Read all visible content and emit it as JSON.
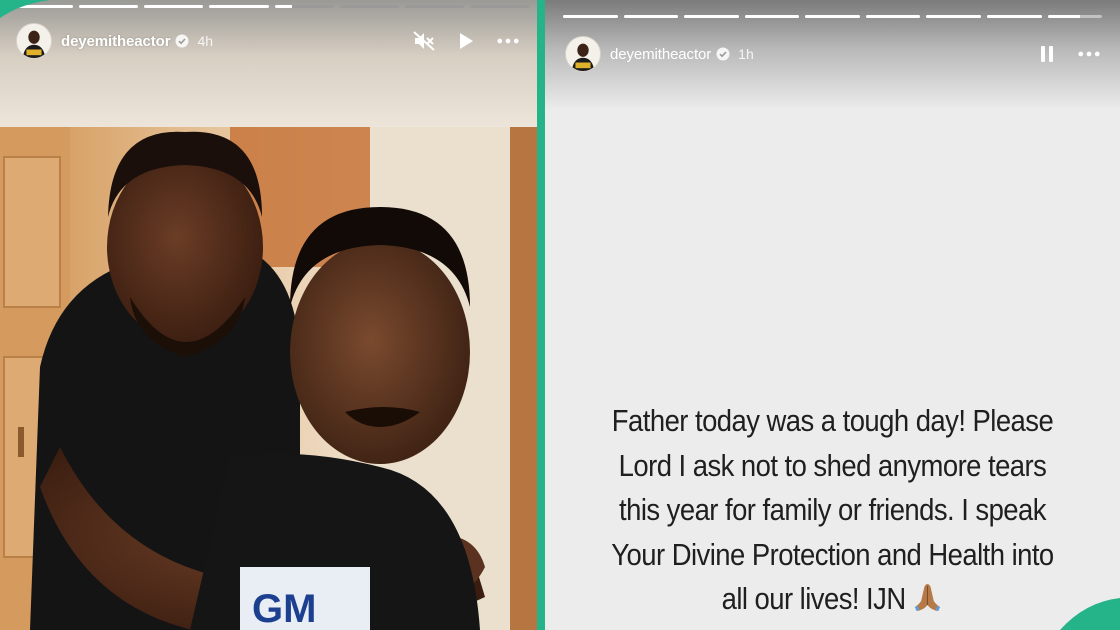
{
  "left_story": {
    "username": "deyemitheactor",
    "timestamp": "4h",
    "progress": [
      1,
      1,
      1,
      1,
      0.3,
      0,
      0,
      0
    ],
    "icons": {
      "mute": "speaker-muted-icon",
      "play": "play-icon",
      "more": "more-icon",
      "verified": "verified-badge-icon"
    },
    "photo": "two-men-piggyback-photo"
  },
  "right_story": {
    "username": "deyemitheactor",
    "timestamp": "1h",
    "progress": [
      1,
      1,
      1,
      1,
      1,
      1,
      1,
      1,
      0.6
    ],
    "icons": {
      "pause": "pause-icon",
      "more": "more-icon",
      "verified": "verified-badge-icon",
      "emoji": "folded-hands-emoji"
    },
    "caption_lines": [
      "Father today was a tough day!  Please",
      "Lord I ask not to shed anymore tears",
      "this year for family or friends. I speak",
      "Your Divine Protection and Health  into",
      "all our lives! IJN"
    ]
  },
  "colors": {
    "divider": "#25b38a",
    "right_background": "#ececec",
    "caption_text": "#1f1f1f"
  }
}
